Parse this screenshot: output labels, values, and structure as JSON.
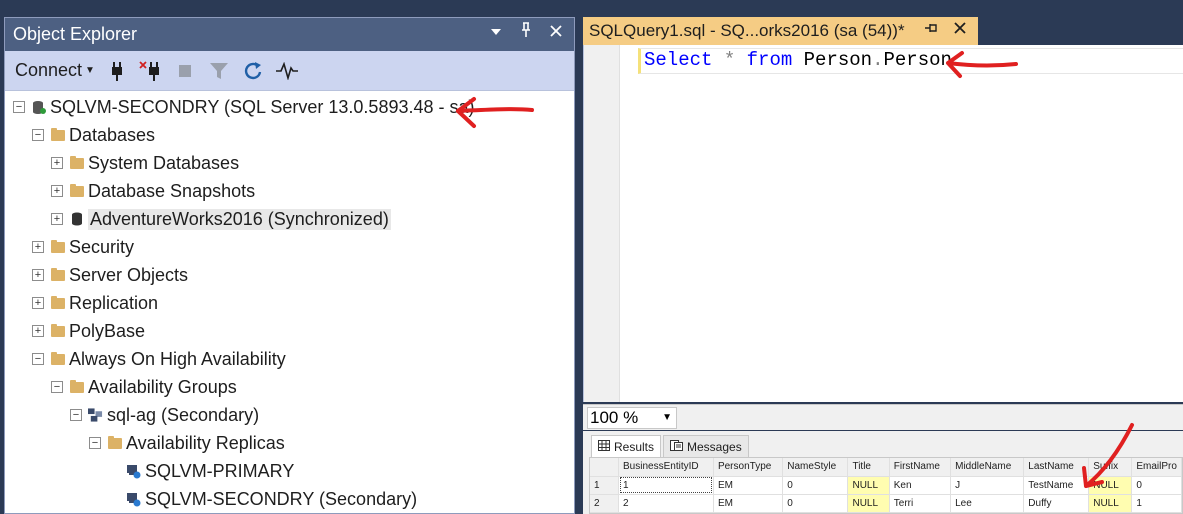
{
  "object_explorer": {
    "title": "Object Explorer",
    "header_icons": [
      "dropdown-arrow-icon",
      "pin-icon",
      "close-icon"
    ],
    "toolbar": {
      "connect_label": "Connect",
      "icons": [
        "connect-plug-icon",
        "disconnect-plug-icon",
        "stop-icon",
        "filter-icon",
        "refresh-icon",
        "activity-monitor-icon"
      ]
    },
    "tree": [
      {
        "label": "SQLVM-SECONDRY (SQL Server 13.0.5893.48 - sa)",
        "icon": "server-icon",
        "expand": "minus",
        "indent": 0
      },
      {
        "label": "Databases",
        "icon": "folder-icon",
        "expand": "minus",
        "indent": 1
      },
      {
        "label": "System Databases",
        "icon": "folder-icon",
        "expand": "plus",
        "indent": 2
      },
      {
        "label": "Database Snapshots",
        "icon": "folder-icon",
        "expand": "plus",
        "indent": 2
      },
      {
        "label": "AdventureWorks2016 (Synchronized)",
        "icon": "database-icon",
        "expand": "plus",
        "indent": 2,
        "selected": true
      },
      {
        "label": "Security",
        "icon": "folder-icon",
        "expand": "plus",
        "indent": 1
      },
      {
        "label": "Server Objects",
        "icon": "folder-icon",
        "expand": "plus",
        "indent": 1
      },
      {
        "label": "Replication",
        "icon": "folder-icon",
        "expand": "plus",
        "indent": 1
      },
      {
        "label": "PolyBase",
        "icon": "folder-icon",
        "expand": "plus",
        "indent": 1
      },
      {
        "label": "Always On High Availability",
        "icon": "folder-icon",
        "expand": "minus",
        "indent": 1
      },
      {
        "label": "Availability Groups",
        "icon": "folder-icon",
        "expand": "minus",
        "indent": 2
      },
      {
        "label": "sql-ag (Secondary)",
        "icon": "availability-group-icon",
        "expand": "minus",
        "indent": 3
      },
      {
        "label": "Availability Replicas",
        "icon": "folder-icon",
        "expand": "minus",
        "indent": 4
      },
      {
        "label": "SQLVM-PRIMARY",
        "icon": "replica-icon",
        "expand": "none",
        "indent": 5
      },
      {
        "label": "SQLVM-SECONDRY (Secondary)",
        "icon": "replica-icon",
        "expand": "none",
        "indent": 5
      }
    ]
  },
  "editor": {
    "tab_title": "SQLQuery1.sql - SQ...orks2016 (sa (54))*",
    "tab_icons": [
      "pin-icon",
      "close-icon"
    ],
    "code": {
      "kw1": "Select",
      "star": "*",
      "kw2": "from",
      "schema": "Person",
      "dot": ".",
      "table": "Person"
    },
    "zoom": "100 %"
  },
  "results": {
    "tabs": [
      {
        "label": "Results",
        "icon": "grid-icon",
        "active": true
      },
      {
        "label": "Messages",
        "icon": "messages-icon",
        "active": false
      }
    ],
    "columns": [
      "BusinessEntityID",
      "PersonType",
      "NameStyle",
      "Title",
      "FirstName",
      "MiddleName",
      "LastName",
      "Suffix",
      "EmailPro"
    ],
    "rows": [
      {
        "num": "1",
        "cells": [
          "1",
          "EM",
          "0",
          "NULL",
          "Ken",
          "J",
          "TestName",
          "NULL",
          "0"
        ]
      },
      {
        "num": "2",
        "cells": [
          "2",
          "EM",
          "0",
          "NULL",
          "Terri",
          "Lee",
          "Duffy",
          "NULL",
          "1"
        ]
      }
    ]
  },
  "colors": {
    "annotation_arrow": "#e02020",
    "panel_header": "#4d6082",
    "toolbar_bg": "#ccd5f0",
    "active_tab": "#f5cc84",
    "sql_keyword": "#0000ff",
    "null_cell": "#fffdb0"
  }
}
